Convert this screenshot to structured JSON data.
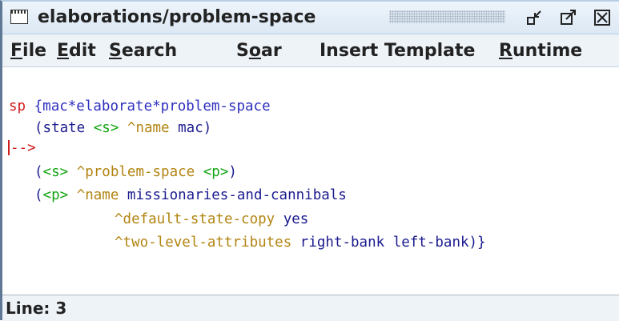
{
  "window": {
    "title": "elaborations/problem-space"
  },
  "menu": {
    "items": [
      {
        "mnemonic": "F",
        "rest": "ile"
      },
      {
        "mnemonic": "E",
        "rest": "dit"
      },
      {
        "mnemonic": "S",
        "rest": "earch"
      },
      {
        "pre": "S",
        "mnemonic": "o",
        "rest": "ar"
      },
      {
        "label": "Insert Template"
      },
      {
        "mnemonic": "R",
        "rest": "untime"
      }
    ]
  },
  "editor": {
    "tokens": {
      "sp": "sp",
      "rule_name": "{mac*elaborate*problem-space",
      "l2_open": "(state ",
      "l2_var": "<s>",
      "l2_attr": " ^name",
      "l2_val": " mac)",
      "arrow": "-->",
      "l4_open": "(",
      "l4_var": "<s>",
      "l4_attr": " ^problem-space",
      "l4_sp": " ",
      "l4_var2": "<p>",
      "l4_close": ")",
      "l5_open": "(",
      "l5_var": "<p>",
      "l5_attr": " ^name",
      "l5_val": " missionaries-and-cannibals",
      "l6_attr": "^default-state-copy",
      "l6_val": " yes",
      "l7_attr": "^two-level-attributes",
      "l7_val": " right-bank left-bank)}"
    }
  },
  "status": {
    "text": "Line: 3"
  },
  "colors": {
    "keyword": "#d11b1b",
    "text": "#1b1b8f",
    "variable": "#14a614",
    "attribute": "#b28512",
    "titlebar": "#dce8f4"
  },
  "icons": {
    "window_icon": "window-icon",
    "minimize": "minimize-icon",
    "maximize": "maximize-icon",
    "close": "close-icon"
  }
}
